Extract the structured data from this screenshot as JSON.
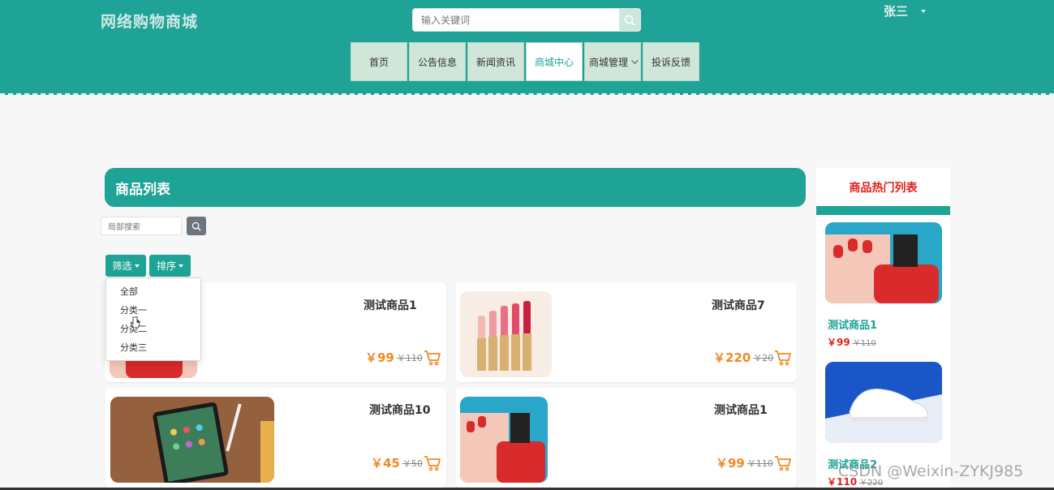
{
  "header": {
    "site_title": "网络购物商城",
    "search_placeholder": "输入关键词",
    "user_name": "张三"
  },
  "nav": {
    "items": [
      {
        "label": "首页"
      },
      {
        "label": "公告信息"
      },
      {
        "label": "新闻资讯"
      },
      {
        "label": "商城中心",
        "active": true
      },
      {
        "label": "商城管理",
        "has_dropdown": true
      },
      {
        "label": "投诉反馈"
      }
    ]
  },
  "main": {
    "list_title": "商品列表",
    "local_search_placeholder": "局部搜索",
    "filter_label": "筛选",
    "sort_label": "排序",
    "filter_options": [
      "全部",
      "分类一",
      "分类二",
      "分类三"
    ],
    "products": [
      {
        "name": "测试商品1",
        "price": "￥99",
        "old_price": "￥110",
        "image": "nail-polish"
      },
      {
        "name": "测试商品7",
        "price": "￥220",
        "old_price": "￥20",
        "image": "lipsticks"
      },
      {
        "name": "测试商品10",
        "price": "￥45",
        "old_price": "￥50",
        "image": "tablet"
      },
      {
        "name": "测试商品1",
        "price": "￥99",
        "old_price": "￥110",
        "image": "nail-polish"
      }
    ]
  },
  "sidebar": {
    "title": "商品热门列表",
    "items": [
      {
        "name": "测试商品1",
        "price": "￥99",
        "old_price": "￥110",
        "image": "nail-polish"
      },
      {
        "name": "测试商品2",
        "price": "￥110",
        "old_price": "￥220",
        "image": "sneaker"
      }
    ]
  },
  "watermark": "CSDN @Weixin-ZYKJ985",
  "colors": {
    "primary": "#1ea396",
    "price": "#f08a24",
    "hot_price": "#e0201c"
  }
}
